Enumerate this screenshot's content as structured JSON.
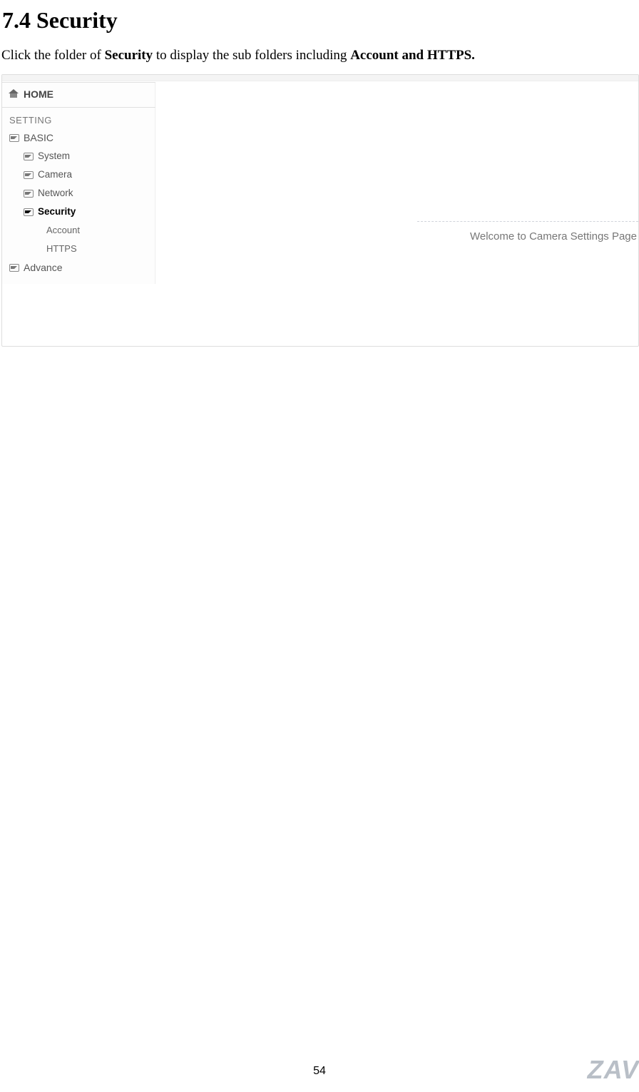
{
  "heading": "7.4 Security",
  "intro": {
    "pre": "Click the folder of ",
    "bold1": "Security",
    "mid": " to display the sub folders including ",
    "bold2": "Account and HTTPS."
  },
  "screenshot": {
    "home_label": "HOME",
    "setting_label": "SETTING",
    "tree": {
      "basic": "BASIC",
      "system": "System",
      "camera": "Camera",
      "network": "Network",
      "security": "Security",
      "account": "Account",
      "https": "HTTPS",
      "advance": "Advance"
    },
    "welcome": "Welcome to Camera Settings Page"
  },
  "page_number": "54",
  "watermark": "ZAV"
}
